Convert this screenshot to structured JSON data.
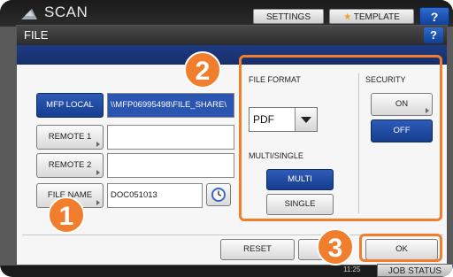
{
  "app": {
    "title": "SCAN",
    "settings_label": "SETTINGS",
    "template_label": "TEMPLATE",
    "help": "?"
  },
  "dialog": {
    "title": "FILE",
    "help": "?",
    "buttons": {
      "mfp_local": "MFP LOCAL",
      "remote1": "REMOTE 1",
      "remote2": "REMOTE 2",
      "file_name": "FILE NAME",
      "reset": "RESET",
      "ok": "OK"
    },
    "fields": {
      "mfp_local_path": "\\\\MFP06995498\\FILE_SHARE\\",
      "remote1": "",
      "remote2": "",
      "file_name": "DOC051013"
    },
    "file_format": {
      "label": "FILE FORMAT",
      "value": "PDF"
    },
    "multi_single": {
      "label": "MULTI/SINGLE",
      "multi": "MULTI",
      "single": "SINGLE",
      "selected": "MULTI"
    },
    "security": {
      "label": "SECURITY",
      "on": "ON",
      "off": "OFF",
      "selected": "OFF"
    }
  },
  "callouts": [
    "1",
    "2",
    "3"
  ],
  "status": {
    "time": "11:25",
    "job_status": "JOB STATUS"
  },
  "colors": {
    "accent": "#f07e2d",
    "selected_blue": "#1f4aa0"
  }
}
